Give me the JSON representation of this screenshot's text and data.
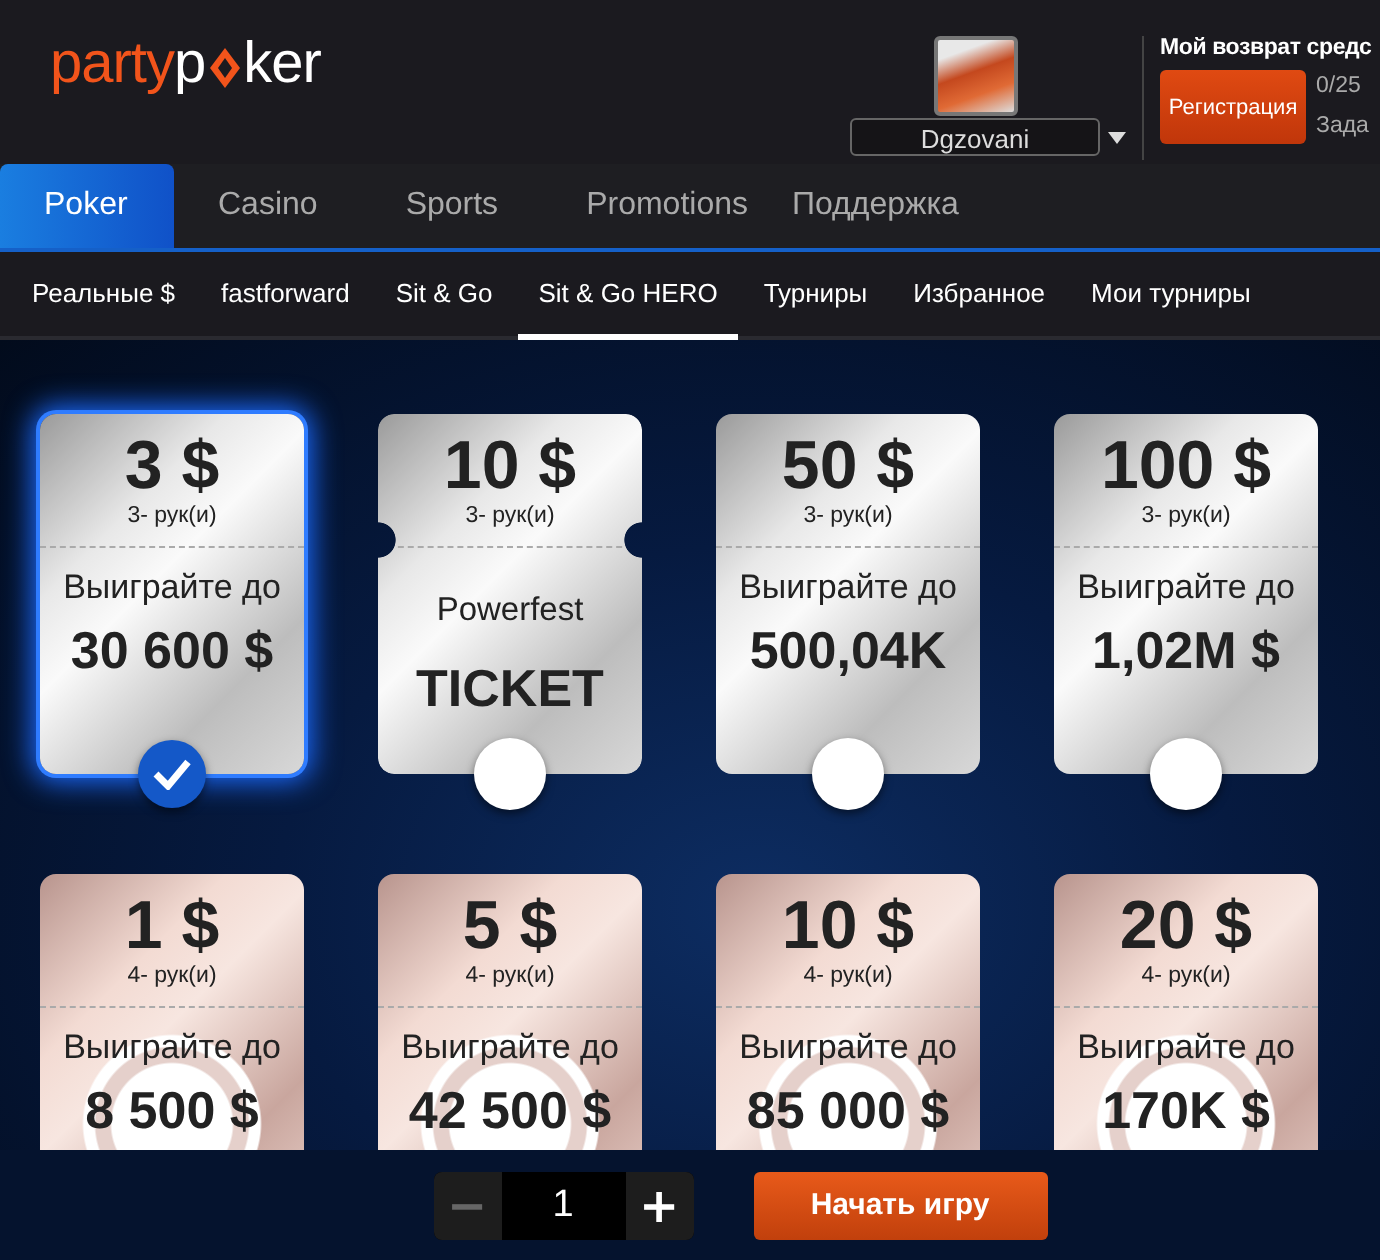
{
  "header": {
    "logo": {
      "first": "party",
      "second_start": "p",
      "second_end": "ker"
    },
    "username": "Dgzovani",
    "promo": {
      "title": "Мой возврат средс",
      "button": "Регистрация",
      "progress": "0/25",
      "task": "Зада"
    }
  },
  "nav": [
    {
      "label": "Poker",
      "selected": true
    },
    {
      "label": "Casino",
      "selected": false
    },
    {
      "label": "Sports",
      "selected": false
    },
    {
      "label": "Promotions",
      "selected": false
    },
    {
      "label": "Поддержка",
      "selected": false
    }
  ],
  "subnav": [
    {
      "label": "Реальные $",
      "selected": false
    },
    {
      "label": "fastforward",
      "selected": false
    },
    {
      "label": "Sit & Go",
      "selected": false
    },
    {
      "label": "Sit & Go HERO",
      "selected": true
    },
    {
      "label": "Турниры",
      "selected": false
    },
    {
      "label": "Избранное",
      "selected": false
    },
    {
      "label": "Мои турниры",
      "selected": false
    }
  ],
  "cards": [
    {
      "kind": "silver",
      "price": "3 $",
      "hands": "3- рук(и)",
      "label": "Выиграйте до",
      "amount": "30 600 $",
      "selected": true
    },
    {
      "kind": "ticket",
      "price": "10 $",
      "hands": "3- рук(и)",
      "label": "Powerfest",
      "amount": "TICKET",
      "selected": false
    },
    {
      "kind": "silver",
      "price": "50 $",
      "hands": "3- рук(и)",
      "label": "Выиграйте до",
      "amount": "500,04K",
      "selected": false
    },
    {
      "kind": "silver",
      "price": "100 $",
      "hands": "3- рук(и)",
      "label": "Выиграйте до",
      "amount": "1,02M $",
      "selected": false
    },
    {
      "kind": "bronze",
      "price": "1 $",
      "hands": "4- рук(и)",
      "label": "Выиграйте до",
      "amount": "8 500 $"
    },
    {
      "kind": "bronze",
      "price": "5 $",
      "hands": "4- рук(и)",
      "label": "Выиграйте до",
      "amount": "42 500 $"
    },
    {
      "kind": "bronze",
      "price": "10 $",
      "hands": "4- рук(и)",
      "label": "Выиграйте до",
      "amount": "85 000 $"
    },
    {
      "kind": "bronze",
      "price": "20 $",
      "hands": "4- рук(и)",
      "label": "Выиграйте до",
      "amount": "170K $"
    }
  ],
  "stepper": {
    "minus": {
      "symbol": "−",
      "disabled": true
    },
    "value": "1",
    "plus": {
      "symbol": "+",
      "disabled": false
    }
  },
  "start_button": "Начать игру"
}
